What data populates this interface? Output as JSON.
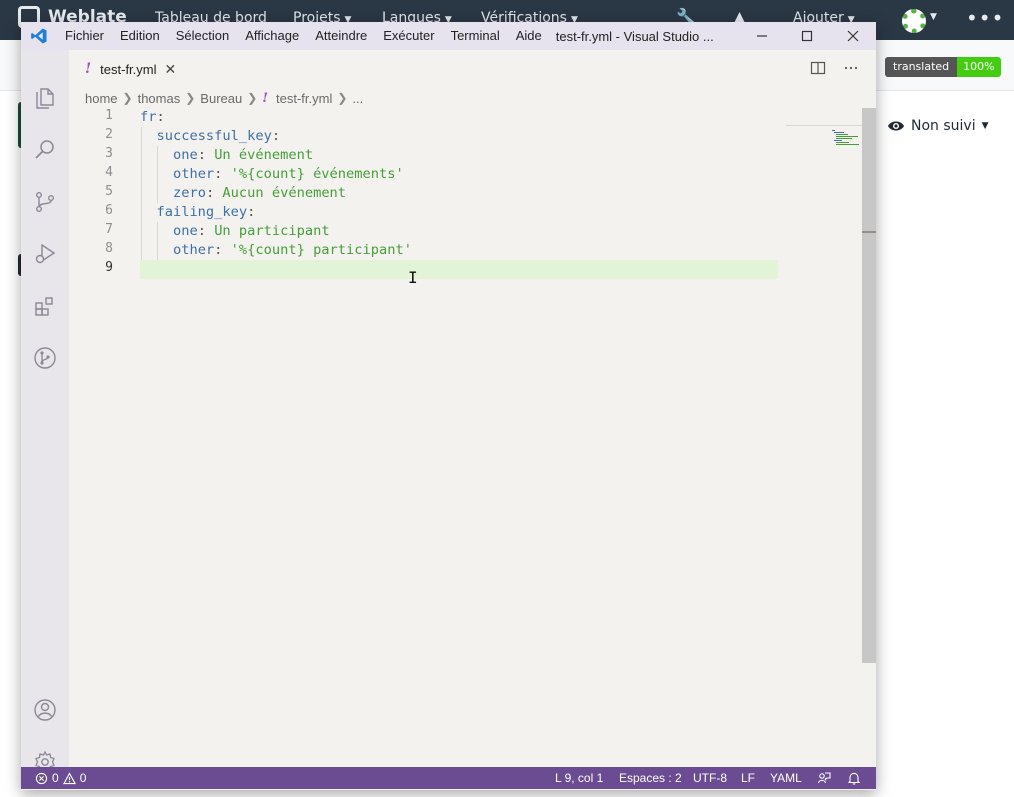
{
  "weblate": {
    "logo_text": "Weblate",
    "nav": [
      {
        "label": "Tableau de bord"
      },
      {
        "label": "Projets"
      },
      {
        "label": "Langues"
      },
      {
        "label": "Vérifications"
      },
      {
        "label": "Ajouter"
      }
    ],
    "badge": {
      "label": "translated",
      "value": "100%"
    },
    "watch_label": "Non suivi",
    "colors": {
      "navbar": "#2a3744",
      "badge_green": "#44cc11"
    }
  },
  "vscode": {
    "window_title": "test-fr.yml - Visual Studio ...",
    "menu": [
      "Fichier",
      "Edition",
      "Sélection",
      "Affichage",
      "Atteindre",
      "Exécuter",
      "Terminal",
      "Aide"
    ],
    "tab": {
      "label": "test-fr.yml",
      "icon": "yaml-icon",
      "close_glyph": "✕"
    },
    "breadcrumb": {
      "parts": [
        "home",
        "thomas",
        "Bureau"
      ],
      "file": "test-fr.yml",
      "ellipsis": "..."
    },
    "yaml_glyph": "!",
    "line_numbers": [
      "1",
      "2",
      "3",
      "4",
      "5",
      "6",
      "7",
      "8",
      "9"
    ],
    "code": [
      {
        "key": "fr",
        "sep": ":",
        "value": ""
      },
      {
        "key": "successful_key",
        "sep": ":",
        "value": ""
      },
      {
        "key": "one",
        "sep": ":",
        "value": " Un événement"
      },
      {
        "key": "other",
        "sep": ":",
        "value": " '%{count} événements'"
      },
      {
        "key": "zero",
        "sep": ":",
        "value": " Aucun événement"
      },
      {
        "key": "failing_key",
        "sep": ":",
        "value": ""
      },
      {
        "key": "one",
        "sep": ":",
        "value": " Un participant"
      },
      {
        "key": "other",
        "sep": ":",
        "value": " '%{count} participant'"
      },
      {
        "key": "",
        "sep": "",
        "value": ""
      }
    ],
    "status": {
      "errors": "0",
      "warnings": "0",
      "position": "L 9, col 1",
      "indent": "Espaces : 2",
      "encoding": "UTF-8",
      "eol": "LF",
      "language": "YAML"
    },
    "colors": {
      "status_bar": "#6b4c93",
      "title_bar": "#e7e3ee",
      "key": "#3f6fa6",
      "value": "#469e39",
      "current_line": "#e3f4d6"
    }
  }
}
